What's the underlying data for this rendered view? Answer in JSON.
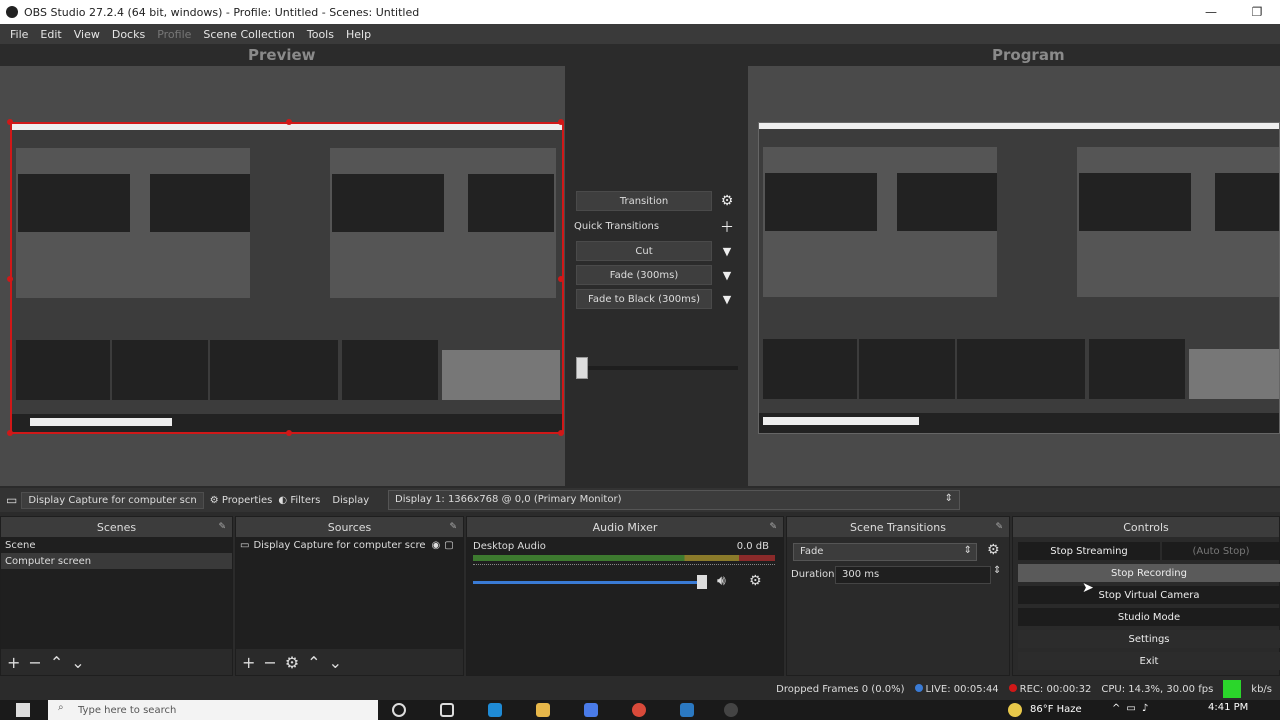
{
  "window": {
    "title": "OBS Studio 27.2.4 (64 bit, windows) - Profile: Untitled - Scenes: Untitled",
    "minimize": "—",
    "maximize": "❐"
  },
  "menu": {
    "items": [
      "File",
      "Edit",
      "View",
      "Docks",
      "Profile",
      "Scene Collection",
      "Tools",
      "Help"
    ]
  },
  "preview": {
    "label": "Preview"
  },
  "program": {
    "label": "Program"
  },
  "transitions_panel": {
    "transition_btn": "Transition",
    "quick_transitions": "Quick Transitions",
    "cut": "Cut",
    "fade": "Fade (300ms)",
    "fade_black": "Fade to Black (300ms)"
  },
  "source_toolbar": {
    "source_name": "Display Capture for computer scn",
    "properties": "Properties",
    "filters": "Filters",
    "display_label": "Display",
    "display_value": "Display 1: 1366x768 @ 0,0 (Primary Monitor)"
  },
  "scenes": {
    "title": "Scenes",
    "items": [
      {
        "label": "Scene"
      },
      {
        "label": "Computer screen"
      }
    ]
  },
  "sources": {
    "title": "Sources",
    "items": [
      {
        "label": "Display Capture for computer scre"
      }
    ]
  },
  "audio_mixer": {
    "title": "Audio Mixer",
    "channel": "Desktop Audio",
    "level": "0.0 dB"
  },
  "scene_transitions": {
    "title": "Scene Transitions",
    "type": "Fade",
    "duration_label": "Duration",
    "duration_value": "300 ms"
  },
  "controls": {
    "title": "Controls",
    "stop_streaming": "Stop Streaming",
    "auto_stop": "(Auto Stop)",
    "stop_recording": "Stop Recording",
    "stop_virtual_camera": "Stop Virtual Camera",
    "studio_mode": "Studio Mode",
    "settings": "Settings",
    "exit": "Exit"
  },
  "status": {
    "dropped": "Dropped Frames 0 (0.0%)",
    "live": "LIVE: 00:05:44",
    "rec": "REC: 00:00:32",
    "cpu": "CPU: 14.3%, 30.00 fps",
    "kbps": "kb/s"
  },
  "taskbar": {
    "search_placeholder": "Type here to search",
    "weather": "86°F  Haze",
    "time": "4:41 PM"
  },
  "colors": {
    "accent_red": "#d01818",
    "live_blue": "#3a7bd5",
    "status_green": "#2bd62b"
  }
}
